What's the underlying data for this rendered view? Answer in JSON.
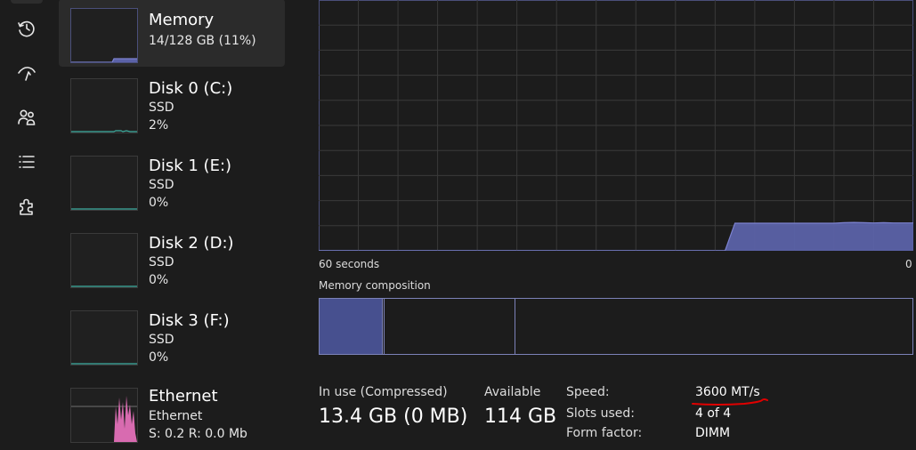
{
  "colors": {
    "background": "#1c1c1c",
    "selected": "#2b2b2b",
    "memory_fill": "#5b62a8",
    "memory_line": "#7c82d0",
    "grid": "#3a3a3a",
    "disk_line": "#3fb0a2",
    "ethernet_fill": "#d86bb0",
    "annotation": "#e00000"
  },
  "rail": {
    "icons": [
      "history-icon",
      "startup-apps-icon",
      "users-icon",
      "details-list-icon",
      "services-icon"
    ]
  },
  "sidebar": {
    "items": [
      {
        "title": "Memory",
        "sub1": "14/128 GB (11%)",
        "sub2": ""
      },
      {
        "title": "Disk 0 (C:)",
        "sub1": "SSD",
        "sub2": "2%"
      },
      {
        "title": "Disk 1 (E:)",
        "sub1": "SSD",
        "sub2": "0%"
      },
      {
        "title": "Disk 2 (D:)",
        "sub1": "SSD",
        "sub2": "0%"
      },
      {
        "title": "Disk 3 (F:)",
        "sub1": "SSD",
        "sub2": "0%"
      },
      {
        "title": "Ethernet",
        "sub1": "Ethernet",
        "sub2": "S: 0.2 R: 0.0 Mb"
      }
    ]
  },
  "graph": {
    "time_left_label": "60 seconds",
    "time_right_label": "0",
    "usage_percent_points": [
      0,
      0,
      0,
      0,
      0,
      0,
      0,
      0,
      0,
      0,
      0,
      0,
      0,
      0,
      0,
      0,
      0,
      0,
      0,
      0,
      0,
      0,
      0,
      0,
      0,
      0,
      0,
      0,
      0,
      0,
      0,
      0,
      0,
      0,
      0,
      0,
      0,
      0,
      0,
      0,
      0,
      0,
      11,
      11,
      11,
      11,
      11,
      11,
      11,
      11,
      11,
      11,
      11,
      11.2,
      11.3,
      11.2,
      11.1,
      11.2,
      11.1,
      11.1,
      11.1
    ]
  },
  "composition": {
    "label": "Memory composition",
    "in_use_fraction": 0.107,
    "modified_fraction": 0.001,
    "standby_fraction": 0.22
  },
  "stats": {
    "in_use_label": "In use (Compressed)",
    "in_use_value": "13.4 GB (0 MB)",
    "available_label": "Available",
    "available_value": "114 GB",
    "speed_label": "Speed:",
    "speed_value": "3600 MT/s",
    "slots_label": "Slots used:",
    "slots_value": "4 of 4",
    "form_label": "Form factor:",
    "form_value": "DIMM"
  }
}
